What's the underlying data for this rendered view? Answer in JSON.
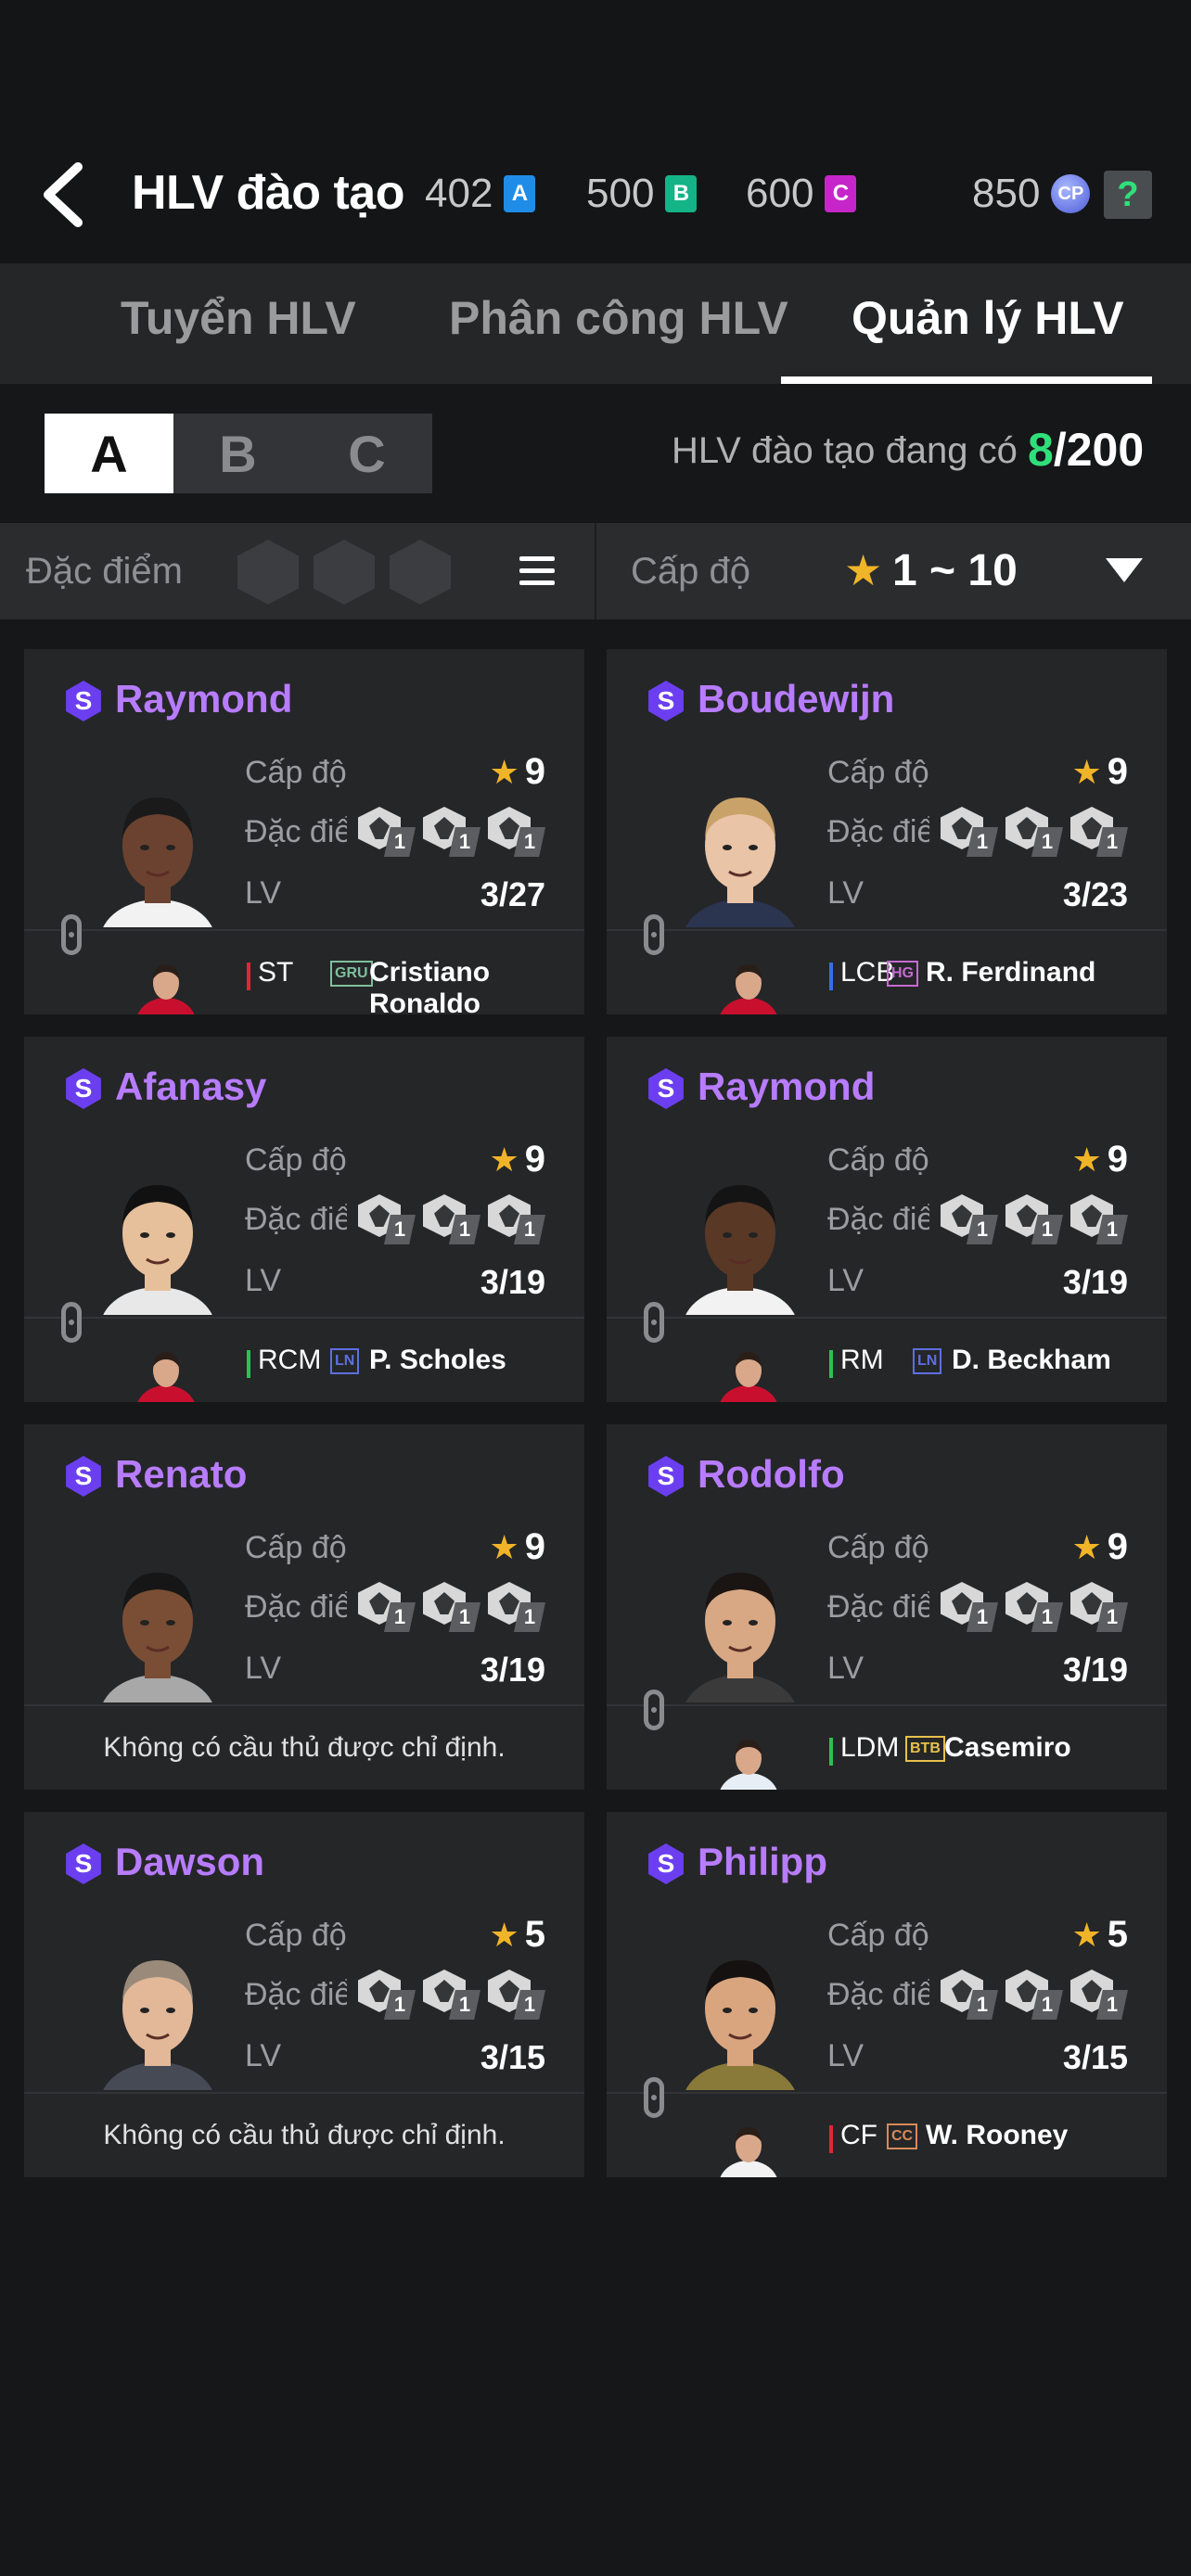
{
  "header": {
    "title": "HLV đào tạo",
    "currencies": [
      {
        "value": "402",
        "icon_letter": "A",
        "color": "#1f8de8"
      },
      {
        "value": "500",
        "icon_letter": "B",
        "color": "#14b487"
      },
      {
        "value": "600",
        "icon_letter": "C",
        "color": "#c626c9"
      },
      {
        "value": "850",
        "icon_letter": "CP",
        "color": "#6d7be8"
      }
    ],
    "help_label": "?"
  },
  "tabs": [
    {
      "label": "Tuyển HLV",
      "active": false
    },
    {
      "label": "Phân công  HLV",
      "active": false
    },
    {
      "label": "Quản lý HLV",
      "active": true
    }
  ],
  "groups": {
    "items": [
      "A",
      "B",
      "C"
    ],
    "active": "A"
  },
  "count": {
    "label": "HLV đào tạo đang có",
    "current": "8",
    "max": "/200"
  },
  "filter": {
    "trait_label": "Đặc điểm c",
    "level_label": "Cấp độ",
    "level_range": "1 ~ 10"
  },
  "labels": {
    "level": "Cấp độ",
    "trait": "Đặc điểm",
    "lv": "LV",
    "grade_badge": "S",
    "no_player": "Không có cầu thủ được chỉ định."
  },
  "coaches": [
    {
      "name": "Raymond",
      "stars": "9",
      "lv": "3/27",
      "traits": [
        "1",
        "1",
        "1"
      ],
      "skin": "#6b4230",
      "hair": "#1a1a1a",
      "shirt": "#f2f2f2",
      "player": {
        "pos": "ST",
        "season": "GRU",
        "season_color": "#7fbf9c",
        "name": "Cristiano Ronaldo",
        "kit": "#c8102e"
      }
    },
    {
      "name": "Boudewijn",
      "stars": "9",
      "lv": "3/23",
      "traits": [
        "1",
        "1",
        "1"
      ],
      "skin": "#e9c4a6",
      "hair": "#c9a26a",
      "shirt": "#2b3550",
      "player": {
        "pos": "LCB",
        "season": "HG",
        "season_color": "#c56bd1",
        "name": "R. Ferdinand",
        "kit": "#c8102e"
      }
    },
    {
      "name": "Afanasy",
      "stars": "9",
      "lv": "3/19",
      "traits": [
        "1",
        "1",
        "1"
      ],
      "skin": "#e6c09a",
      "hair": "#111111",
      "shirt": "#e8e8e8",
      "player": {
        "pos": "RCM",
        "season": "LN",
        "season_color": "#5d6fe0",
        "name": "P. Scholes",
        "kit": "#c8102e"
      }
    },
    {
      "name": "Raymond",
      "stars": "9",
      "lv": "3/19",
      "traits": [
        "1",
        "1",
        "1"
      ],
      "skin": "#5a3826",
      "hair": "#141414",
      "shirt": "#f2f2f2",
      "player": {
        "pos": "RM",
        "season": "LN",
        "season_color": "#5d6fe0",
        "name": "D. Beckham",
        "kit": "#c8102e"
      }
    },
    {
      "name": "Renato",
      "stars": "9",
      "lv": "3/19",
      "traits": [
        "1",
        "1",
        "1"
      ],
      "skin": "#7a4e35",
      "hair": "#161616",
      "shirt": "#a8a8a8",
      "player": null
    },
    {
      "name": "Rodolfo",
      "stars": "9",
      "lv": "3/19",
      "traits": [
        "1",
        "1",
        "1"
      ],
      "skin": "#d8a884",
      "hair": "#1a1412",
      "shirt": "#3a3a3a",
      "player": {
        "pos": "LDM",
        "season": "BTB",
        "season_color": "#e8c04a",
        "name": "Casemiro",
        "kit": "#e8eef6"
      }
    },
    {
      "name": "Dawson",
      "stars": "5",
      "lv": "3/15",
      "traits": [
        "1",
        "1",
        "1"
      ],
      "skin": "#e2b898",
      "hair": "#9a8a7a",
      "shirt": "#454a55",
      "player": null
    },
    {
      "name": "Philipp",
      "stars": "5",
      "lv": "3/15",
      "traits": [
        "1",
        "1",
        "1"
      ],
      "skin": "#d9a57f",
      "hair": "#141110",
      "shirt": "#8a7a3a",
      "player": {
        "pos": "CF",
        "season": "CC",
        "season_color": "#d88a5a",
        "name": "W. Rooney",
        "kit": "#f2f2f2"
      }
    }
  ],
  "colors": {
    "accent_green": "#2fe07a",
    "name_purple": "#b77cff",
    "star_gold": "#f0b429",
    "pos_bar_attack": "#e0263a",
    "pos_bar_mid": "#2fbf55",
    "pos_bar_def": "#3a6ce8"
  }
}
